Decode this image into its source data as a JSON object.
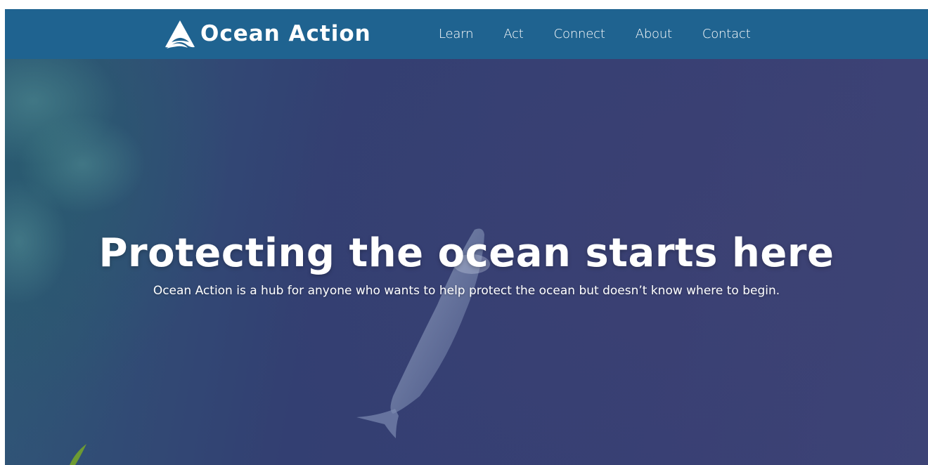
{
  "header": {
    "brand_name": "Ocean Action",
    "logo_icon": "wave-peak-logo-icon",
    "nav": [
      {
        "label": "Learn"
      },
      {
        "label": "Act"
      },
      {
        "label": "Connect"
      },
      {
        "label": "About"
      },
      {
        "label": "Contact"
      }
    ]
  },
  "hero": {
    "title": "Protecting the ocean starts here",
    "subtitle": "Ocean Action is a hub for anyone who wants to help protect the ocean but doesn’t know where to begin.",
    "background_image": "aerial-whale-ocean-image"
  },
  "colors": {
    "navbar": "#1f6390",
    "ocean_deep": "#373f74",
    "ocean_teal": "#2f5878",
    "text": "#ffffff",
    "leaf": "#6d9a32"
  }
}
